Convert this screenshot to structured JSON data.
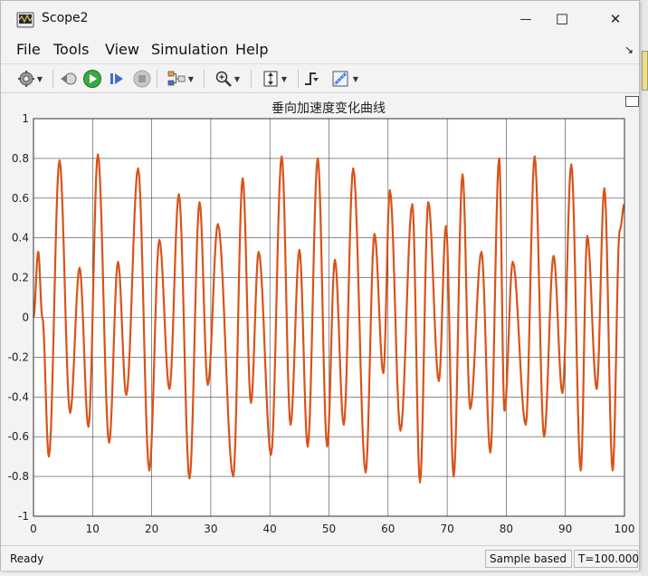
{
  "window": {
    "title": "Scope2",
    "minimize_glyph": "—",
    "maximize_glyph": "☐",
    "close_glyph": "✕"
  },
  "menu": {
    "items": [
      "File",
      "Tools",
      "View",
      "Simulation",
      "Help"
    ],
    "dock_glyph": "↘"
  },
  "toolbar": {
    "icons": [
      "gear-icon",
      "step-back-icon",
      "run-icon",
      "step-forward-icon",
      "stop-icon",
      "signal-select-icon",
      "zoom-icon",
      "fit-axes-icon",
      "trigger-icon",
      "measure-icon"
    ]
  },
  "status": {
    "ready": "Ready",
    "mode": "Sample based",
    "time": "T=100.000"
  },
  "colors": {
    "line": "#d95319",
    "grid": "#2b2b2b",
    "axes_bg": "#ffffff",
    "run_green": "#3aa845"
  },
  "chart_data": {
    "type": "line",
    "title": "垂向加速度变化曲线",
    "xlabel": "",
    "ylabel": "",
    "xlim": [
      0,
      100
    ],
    "ylim": [
      -1,
      1
    ],
    "x_ticks": [
      "0",
      "10",
      "20",
      "30",
      "40",
      "50",
      "60",
      "70",
      "80",
      "90",
      "100"
    ],
    "y_ticks": [
      "1",
      "0.8",
      "0.6",
      "0.4",
      "0.2",
      "0",
      "-0.2",
      "-0.4",
      "-0.6",
      "-0.8",
      "-1"
    ],
    "grid": true,
    "series": [
      {
        "name": "",
        "x": [
          0,
          0.8,
          1.5,
          2.6,
          4.4,
          6.2,
          7.8,
          9.3,
          10.9,
          12.8,
          14.3,
          15.7,
          17.7,
          19.6,
          21.3,
          23.0,
          24.6,
          26.4,
          28.1,
          29.5,
          31.2,
          33.8,
          35.4,
          36.8,
          38.1,
          40.2,
          42.0,
          43.5,
          45.0,
          46.4,
          48.1,
          49.7,
          51.0,
          52.5,
          54.1,
          56.2,
          57.7,
          59.2,
          60.3,
          62.1,
          64.1,
          65.4,
          66.8,
          68.6,
          69.8,
          71.1,
          72.6,
          73.9,
          75.8,
          77.3,
          78.8,
          79.7,
          81.1,
          83.3,
          84.8,
          86.4,
          88.0,
          89.5,
          91.0,
          92.6,
          93.7,
          95.3,
          96.6,
          98.0,
          99.2,
          100.0
        ],
        "y": [
          0.0,
          0.33,
          0.0,
          -0.7,
          0.79,
          -0.48,
          0.25,
          -0.55,
          0.82,
          -0.63,
          0.28,
          -0.39,
          0.75,
          -0.77,
          0.39,
          -0.36,
          0.62,
          -0.81,
          0.58,
          -0.34,
          0.47,
          -0.8,
          0.7,
          -0.43,
          0.33,
          -0.69,
          0.81,
          -0.54,
          0.34,
          -0.65,
          0.8,
          -0.65,
          0.29,
          -0.54,
          0.75,
          -0.78,
          0.42,
          -0.28,
          0.64,
          -0.57,
          0.57,
          -0.83,
          0.58,
          -0.32,
          0.46,
          -0.8,
          0.72,
          -0.46,
          0.33,
          -0.68,
          0.8,
          -0.47,
          0.28,
          -0.54,
          0.81,
          -0.6,
          0.31,
          -0.38,
          0.77,
          -0.77,
          0.41,
          -0.36,
          0.65,
          -0.77,
          0.44,
          0.57
        ]
      }
    ]
  }
}
